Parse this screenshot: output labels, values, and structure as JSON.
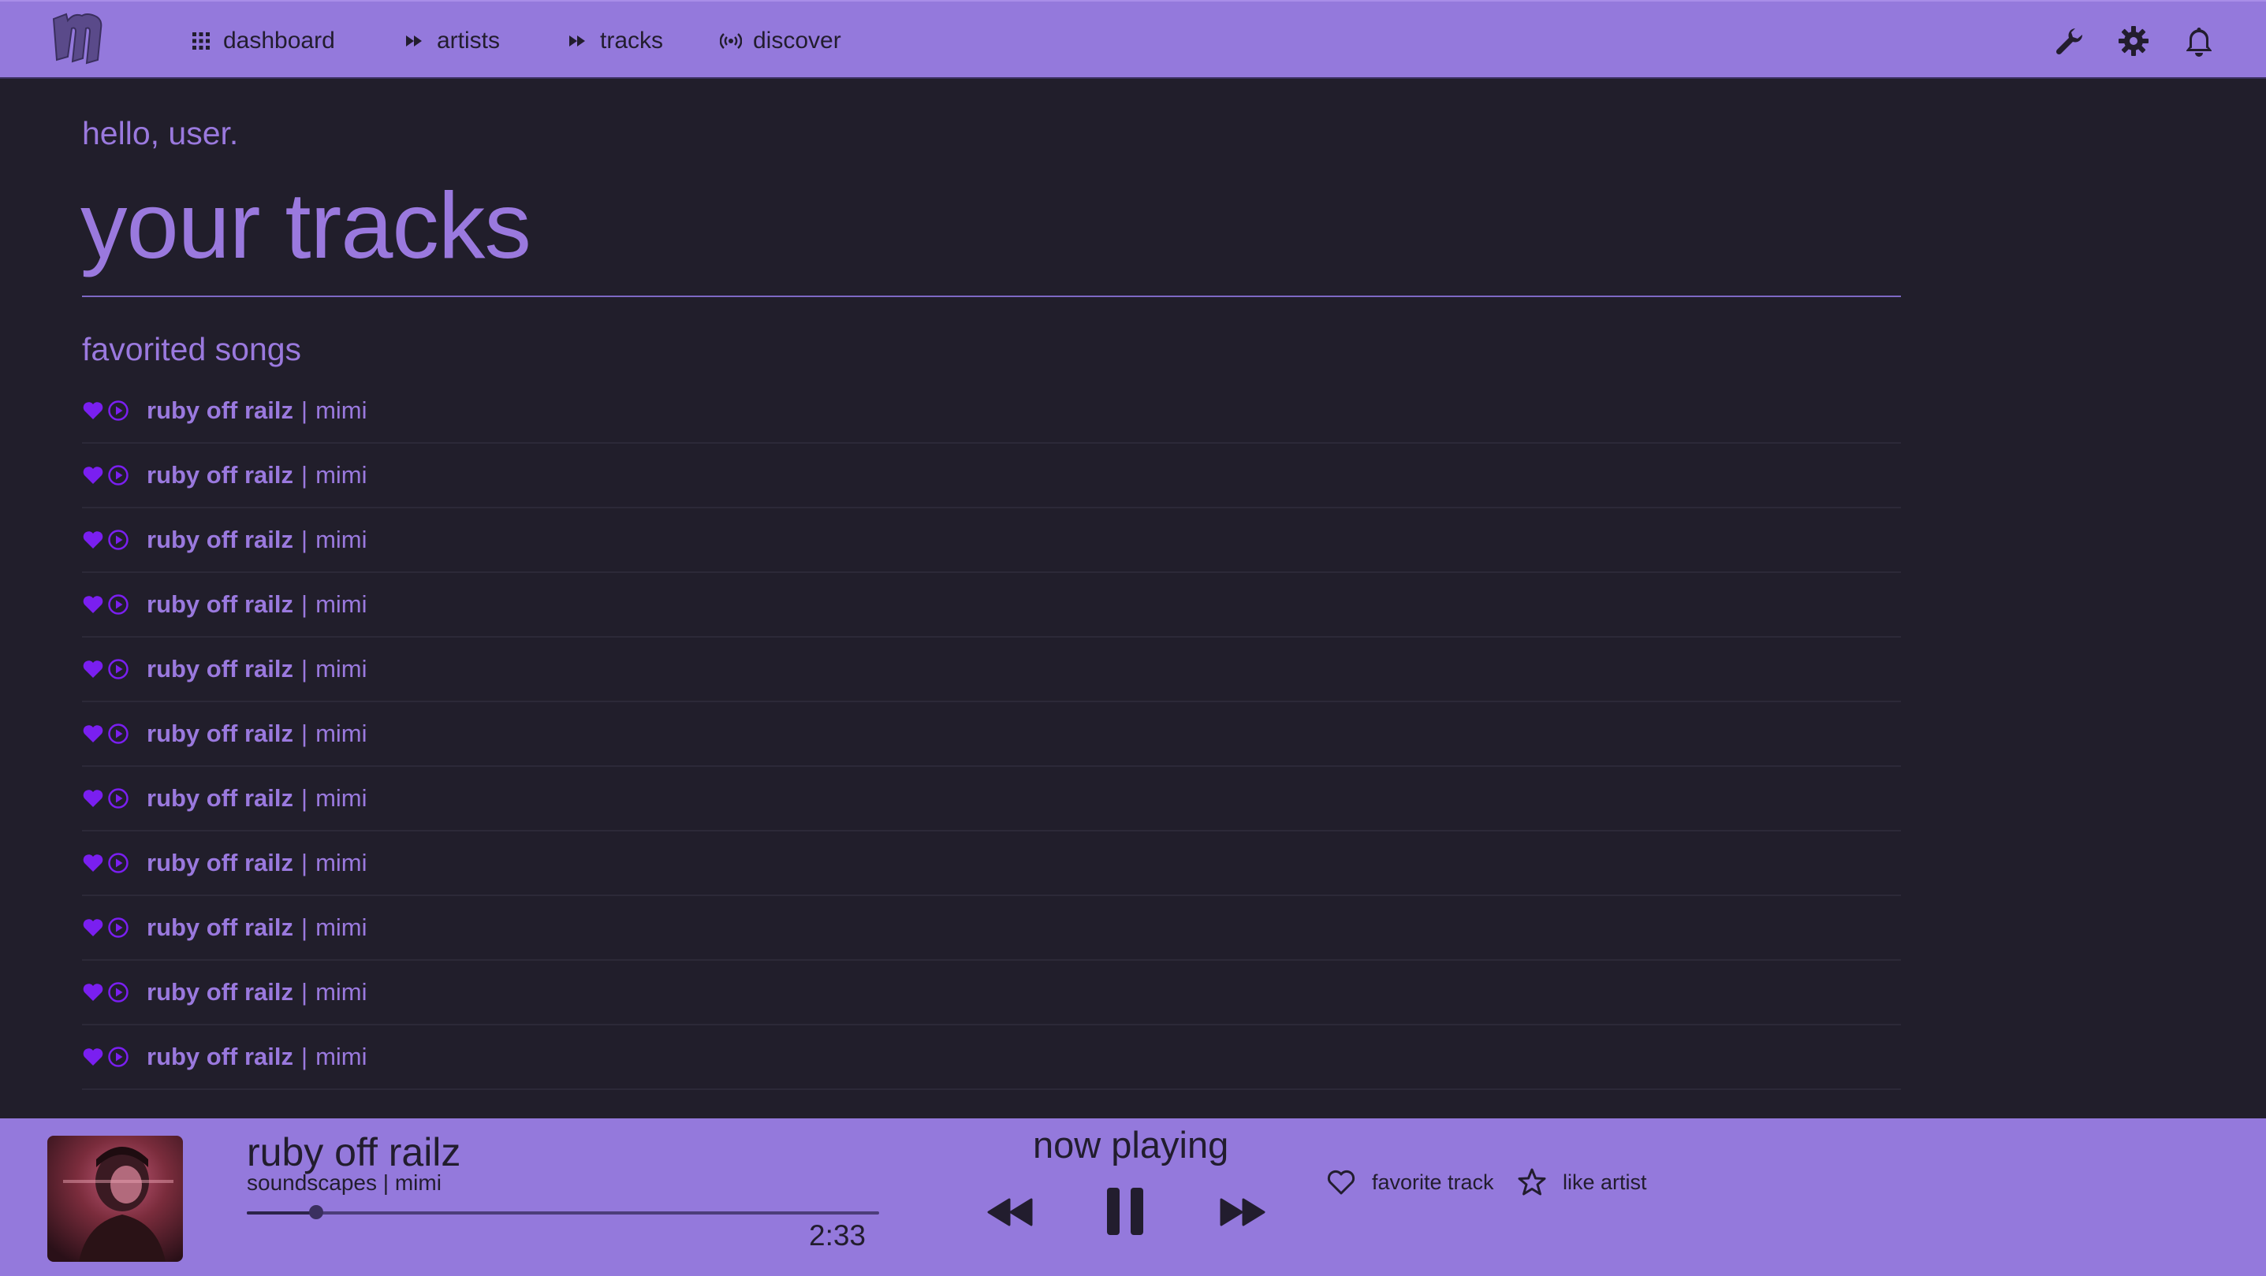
{
  "colors": {
    "accent": "#9479dc",
    "background": "#211e2b",
    "text_accent": "#9a79de",
    "icon_purple": "#7a1ff0",
    "bar_text": "#221d2e"
  },
  "nav": {
    "logo_icon": "m-logo",
    "items": [
      {
        "label": "dashboard",
        "icon": "grid-icon"
      },
      {
        "label": "artists",
        "icon": "fast-forward-icon"
      },
      {
        "label": "tracks",
        "icon": "fast-forward-icon"
      },
      {
        "label": "discover",
        "icon": "broadcast-icon"
      }
    ],
    "right_icons": [
      "wrench-icon",
      "gear-icon",
      "bell-icon"
    ]
  },
  "greeting": "hello, user.",
  "page_title": "your tracks",
  "section_title": "favorited songs",
  "tracks": [
    {
      "title": "ruby off railz",
      "separator": "|",
      "artist": "mimi"
    },
    {
      "title": "ruby off railz",
      "separator": "|",
      "artist": "mimi"
    },
    {
      "title": "ruby off railz",
      "separator": "|",
      "artist": "mimi"
    },
    {
      "title": "ruby off railz",
      "separator": "|",
      "artist": "mimi"
    },
    {
      "title": "ruby off railz",
      "separator": "|",
      "artist": "mimi"
    },
    {
      "title": "ruby off railz",
      "separator": "|",
      "artist": "mimi"
    },
    {
      "title": "ruby off railz",
      "separator": "|",
      "artist": "mimi"
    },
    {
      "title": "ruby off railz",
      "separator": "|",
      "artist": "mimi"
    },
    {
      "title": "ruby off railz",
      "separator": "|",
      "artist": "mimi"
    },
    {
      "title": "ruby off railz",
      "separator": "|",
      "artist": "mimi"
    },
    {
      "title": "ruby off railz",
      "separator": "|",
      "artist": "mimi"
    }
  ],
  "player": {
    "title": "ruby off railz",
    "subtitle": "soundscapes | mimi",
    "time": "2:33",
    "progress": 0.11,
    "now_playing_label": "now playing",
    "favorite_label": "favorite track",
    "like_artist_label": "like artist",
    "controls": [
      "rewind-icon",
      "pause-icon",
      "fast-forward-icon"
    ]
  }
}
